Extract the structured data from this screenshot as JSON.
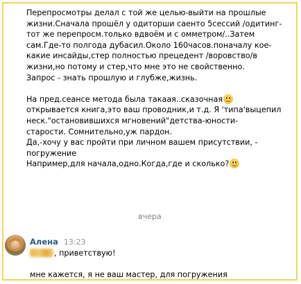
{
  "messages": {
    "lines": [
      "Перепросмотры делал с той же целью-выйти на прошлые",
      "жизни.Сначала прошёл у одиторши саенто 5сессий /одитинг-",
      "тот же перепросм.только вдвоём и с омметром/..Затем",
      "сам.Где-то полгода дубасил.Около 160часов.поначалу кое-",
      "какие инсайды,стер полностью прецедент /воровство/в",
      "жизни,но потому и стер,что мне это не свойственно.",
      "Запрос - знать прошлую и глубже,жизнь.",
      "",
      "На пред.сеансе метода была такаая..сказочная",
      "открывается книга,это ваш проводник,и т.д. Я 'типа'выцепил",
      "неск.\"остановившихся мгновений\"детства-юности-",
      "старости. Сомнительно,уж пардон.",
      "Да,-хочу у вас пройти при личном вашем присутствии, -",
      "погружение",
      "Например,для начала,одно.Когда,где и сколько?"
    ]
  },
  "date_separator": "вчера",
  "next_message": {
    "sender_name": "Алена",
    "time": "13:23",
    "avatar_icon": "user-avatar-photo",
    "greeting_suffix": ", приветствую!",
    "text": "мне кажется, я не ваш мастер, для погружения"
  },
  "emoji_icon": "smiling-face-emoji"
}
